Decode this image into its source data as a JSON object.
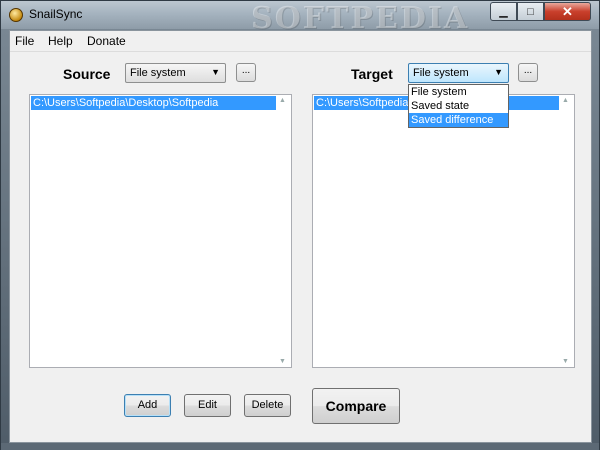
{
  "window": {
    "title": "SnailSync",
    "watermark": "SOFTPEDIA"
  },
  "menu": [
    "File",
    "Help",
    "Donate"
  ],
  "source": {
    "label": "Source",
    "combo_value": "File system",
    "browse_label": "...",
    "items": [
      "C:\\Users\\Softpedia\\Desktop\\Softpedia"
    ]
  },
  "target": {
    "label": "Target",
    "combo_value": "File system",
    "browse_label": "...",
    "items": [
      "C:\\Users\\Softpedia\\Desktop\\Softpedia"
    ]
  },
  "target_dropdown": {
    "options": [
      "File system",
      "Saved state",
      "Saved difference"
    ],
    "highlighted": "Saved difference"
  },
  "buttons": {
    "add": "Add",
    "edit": "Edit",
    "delete": "Delete",
    "compare": "Compare"
  },
  "colors": {
    "selection": "#3399ff",
    "close_button": "#c9402c"
  }
}
